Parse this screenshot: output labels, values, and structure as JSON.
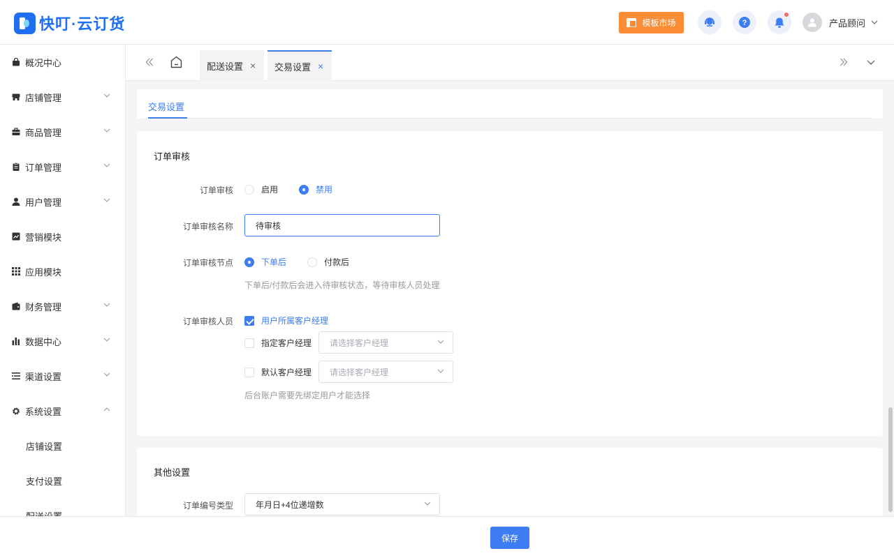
{
  "app": {
    "title": "快叮·云订货"
  },
  "header": {
    "market_label": "模板市场",
    "user_name": "产品顾问",
    "icons": [
      "customer-service-icon",
      "help-icon",
      "bell-icon"
    ],
    "accent": "#3d7cf3",
    "market_color": "#fa8c35"
  },
  "sidebar": {
    "items": [
      {
        "label": "概况中心",
        "icon": "bag-icon"
      },
      {
        "label": "店铺管理",
        "icon": "store-icon"
      },
      {
        "label": "商品管理",
        "icon": "briefcase-icon"
      },
      {
        "label": "订单管理",
        "icon": "clipboard-icon"
      },
      {
        "label": "用户管理",
        "icon": "user-icon"
      },
      {
        "label": "营销模块",
        "icon": "chart-line-icon"
      },
      {
        "label": "应用模块",
        "icon": "grid-icon"
      },
      {
        "label": "财务管理",
        "icon": "wallet-icon"
      },
      {
        "label": "数据中心",
        "icon": "bar-chart-icon"
      },
      {
        "label": "渠道设置",
        "icon": "list-icon"
      },
      {
        "label": "系统设置",
        "icon": "gear-icon"
      }
    ],
    "sub_items": [
      "店铺设置",
      "支付设置",
      "配送设置"
    ]
  },
  "tabs": [
    {
      "label": "配送设置",
      "close": "×"
    },
    {
      "label": "交易设置",
      "close": "×"
    }
  ],
  "subtab": "交易设置",
  "audit": {
    "title": "订单审核",
    "enable_label": "订单审核",
    "enable_options": [
      "启用",
      "禁用"
    ],
    "name_label": "订单审核名称",
    "name_value": "待审核",
    "node_label": "订单审核节点",
    "node_options": [
      "下单后",
      "付款后"
    ],
    "node_hint": "下单后/付款后会进入待审核状态，等待审核人员处理",
    "people_label": "订单审核人员",
    "people_option1": "用户所属客户经理",
    "people_option2": "指定客户经理",
    "people_option3": "默认客户经理",
    "select_placeholder": "请选择客户经理",
    "people_hint": "后台账户需要先绑定用户才能选择"
  },
  "other": {
    "title": "其他设置",
    "order_no_label": "订单编号类型",
    "order_no_value": "年月日+4位递增数"
  },
  "footer": {
    "save_label": "保存"
  }
}
